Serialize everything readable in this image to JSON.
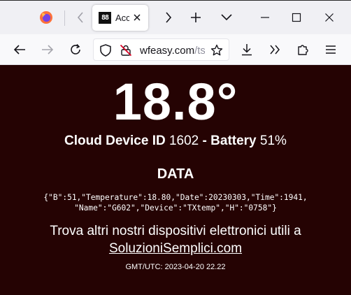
{
  "browser": {
    "tab": {
      "title": "Acc",
      "favicon_text": "88"
    },
    "url": {
      "domain": "wfeasy.com",
      "path": "/ts"
    },
    "icons": {
      "firefox": "firefox-logo",
      "back": "arrow-left",
      "forward": "arrow-right",
      "reload": "reload",
      "shield": "tracking-shield",
      "insecure": "lock-crossed",
      "bookmark": "star",
      "download": "download-arrow",
      "overflow": "double-chevron",
      "extensions": "puzzle",
      "menu": "hamburger"
    },
    "colors": {
      "chrome": "#f0f0f4",
      "toolbar": "#f9f9fb",
      "insecure_red": "#d70022"
    }
  },
  "page": {
    "background": "#250303",
    "temperature": "18.8°",
    "device": {
      "label": "Cloud Device ID",
      "id": "1602",
      "separator": "-",
      "battery_label": "Battery",
      "battery_value": "51%"
    },
    "data_heading": "DATA",
    "json_line1": "{\"B\":51,\"Temperature\":18.80,\"Date\":20230303,\"Time\":1941,",
    "json_line2": "\"Name\":\"G602\",\"Device\":\"TXtemp\",\"H\":\"0758\"}",
    "promo_text": "Trova altri nostri dispositivi elettronici utili a",
    "site_link": "SoluzioniSemplici.com",
    "utc_line": "GMT/UTC: 2023-04-20 22.22"
  }
}
